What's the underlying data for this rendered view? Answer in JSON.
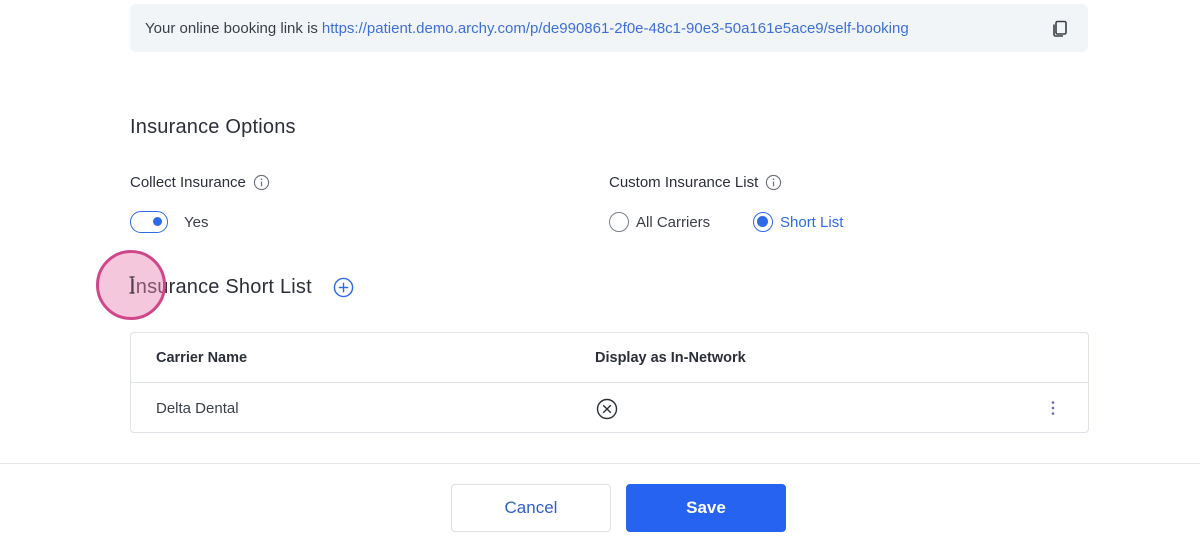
{
  "booking_banner": {
    "prefix": "Your online booking link is",
    "url": "https://patient.demo.archy.com/p/de990861-2f0e-48c1-90e3-50a161e5ace9/self-booking",
    "copy_icon": "copy-icon"
  },
  "insurance_options": {
    "title": "Insurance Options",
    "collect_insurance": {
      "label": "Collect Insurance",
      "info_icon": "info-icon",
      "toggle_on": true,
      "toggle_label": "Yes"
    },
    "custom_list": {
      "label": "Custom Insurance List",
      "info_icon": "info-icon",
      "options": [
        {
          "label": "All Carriers",
          "selected": false
        },
        {
          "label": "Short List",
          "selected": true
        }
      ]
    }
  },
  "short_list": {
    "title": "Insurance Short List",
    "add_icon": "plus-circle-icon",
    "columns": [
      "Carrier Name",
      "Display as In-Network"
    ],
    "rows": [
      {
        "carrier": "Delta Dental",
        "in_network_icon": "x-circle-icon",
        "menu_icon": "kebab-menu-icon"
      }
    ]
  },
  "footer": {
    "cancel_label": "Cancel",
    "save_label": "Save"
  },
  "colors": {
    "primary": "#2563f0",
    "link": "#3d6fd6",
    "banner_bg": "#f2f5f8",
    "cursor_highlight": "#d0468a"
  }
}
